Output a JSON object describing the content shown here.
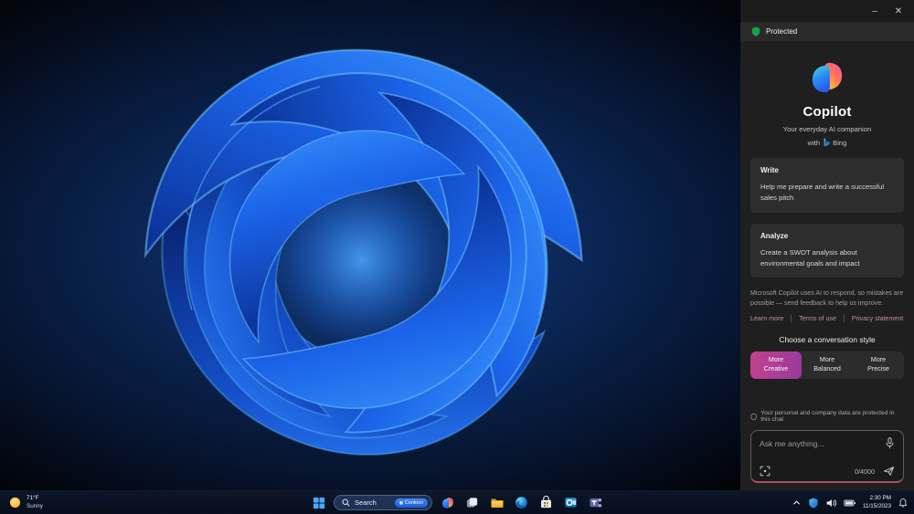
{
  "window_controls": {
    "minimize_glyph": "–",
    "close_glyph": "✕"
  },
  "copilot_panel": {
    "protected_label": "Protected",
    "hero": {
      "title": "Copilot",
      "subtitle": "Your everyday AI companion",
      "with_prefix": "with",
      "bing_label": "Bing"
    },
    "cards": [
      {
        "category": "Write",
        "text": "Help me prepare and write a successful sales pitch"
      },
      {
        "category": "Analyze",
        "text": "Create a SWOT analysis about environmental goals and impact"
      }
    ],
    "disclaimer": "Microsoft Copilot uses AI to respond, so mistakes are possible — send feedback to help us improve.",
    "links": [
      {
        "label": "Learn more"
      },
      {
        "label": "Terms of use"
      },
      {
        "label": "Privacy statement"
      }
    ],
    "style_chooser": {
      "heading": "Choose a conversation style",
      "options": [
        {
          "line1": "More",
          "line2": "Creative",
          "selected": true
        },
        {
          "line1": "More",
          "line2": "Balanced",
          "selected": false
        },
        {
          "line1": "More",
          "line2": "Precise",
          "selected": false
        }
      ]
    },
    "privacy_note": "Your personal and company data are protected in this chat",
    "composer": {
      "placeholder": "Ask me anything...",
      "char_counter": "0/4000"
    },
    "icon_names": [
      "protected-shield-icon",
      "copilot-logo",
      "bing-icon",
      "privacy-shield-icon",
      "mic-icon",
      "screenshot-icon",
      "send-icon"
    ]
  },
  "taskbar": {
    "weather": {
      "temperature": "71°F",
      "condition": "Sunny"
    },
    "search": {
      "label": "Search",
      "badge": "Contoso"
    },
    "app_icons": [
      "start",
      "search",
      "copilot",
      "task-view",
      "file-explorer",
      "edge",
      "microsoft-store",
      "outlook",
      "teams"
    ],
    "tray": {
      "icons": [
        "hidden-icons-chevron",
        "security-shield",
        "volume",
        "battery",
        "notification-bell"
      ],
      "time": "2:30 PM",
      "date": "11/15/2023"
    }
  },
  "colors": {
    "selected_style_accent": "#c2418e",
    "protected_green": "#16a34a",
    "link_pink": "#c28ea5",
    "composer_underline": "#a84f5f",
    "taskbar_bg": "#0b1426"
  }
}
